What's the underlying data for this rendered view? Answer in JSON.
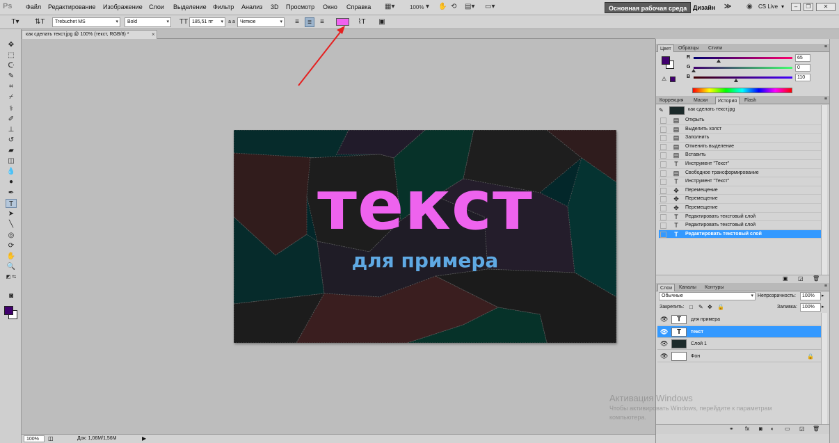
{
  "app": {
    "logo": "Ps"
  },
  "menu": [
    "Файл",
    "Редактирование",
    "Изображение",
    "Слои",
    "Выделение",
    "Фильтр",
    "Анализ",
    "3D",
    "Просмотр",
    "Окно",
    "Справка"
  ],
  "menubar": {
    "zoom": "100%",
    "workspace_active": "Основная рабочая среда",
    "workspace_design": "Дизайн",
    "more": "≫",
    "cs_live": "CS Live"
  },
  "options": {
    "font_family": "Trebuchet MS",
    "font_style": "Bold",
    "font_size": "185,51 пт",
    "aa_label": "a a",
    "antialias": "Четкое",
    "text_color": "#f062f0"
  },
  "document": {
    "tab_title": "как сделать текст.jpg @ 100% (текст, RGB/8) *",
    "close": "×"
  },
  "canvas": {
    "title_text": "текст",
    "subtitle_text": "для примера"
  },
  "status": {
    "zoom": "100%",
    "doc_info": "Док: 1,06М/1,56М",
    "arrow": "▶"
  },
  "color_panel": {
    "tabs": [
      "Цвет",
      "Образцы",
      "Стили"
    ],
    "r_label": "R",
    "g_label": "G",
    "b_label": "B",
    "r": "65",
    "g": "0",
    "b": "110",
    "r_level": 0.255,
    "g_level": 0.0,
    "b_level": 0.431
  },
  "history_panel": {
    "tabs": [
      "Коррекция",
      "Маски",
      "История",
      "Flash"
    ],
    "snapshot": "как сделать текст.jpg",
    "items": [
      {
        "label": "Открыть",
        "icon": "doc-icon"
      },
      {
        "label": "Выделить холст",
        "icon": "doc-icon"
      },
      {
        "label": "Заполнить",
        "icon": "doc-icon"
      },
      {
        "label": "Отменить выделение",
        "icon": "doc-icon"
      },
      {
        "label": "Вставить",
        "icon": "doc-icon"
      },
      {
        "label": "Инструмент \"Текст\"",
        "icon": "text-icon"
      },
      {
        "label": "Свободное трансформирование",
        "icon": "doc-icon"
      },
      {
        "label": "Инструмент \"Текст\"",
        "icon": "text-icon"
      },
      {
        "label": "Перемещение",
        "icon": "move-icon"
      },
      {
        "label": "Перемещение",
        "icon": "move-icon"
      },
      {
        "label": "Перемещение",
        "icon": "move-icon"
      },
      {
        "label": "Редактировать текстовый слой",
        "icon": "text-icon"
      },
      {
        "label": "Редактировать текстовый слой",
        "icon": "text-icon"
      },
      {
        "label": "Редактировать текстовый слой",
        "icon": "text-icon"
      }
    ]
  },
  "layers_panel": {
    "tabs": [
      "Слои",
      "Каналы",
      "Контуры"
    ],
    "blend_mode": "Обычные",
    "opacity_label": "Непрозрачность:",
    "opacity": "100%",
    "lock_label": "Закрепить:",
    "fill_label": "Заливка:",
    "fill": "100%",
    "layers": [
      {
        "name": "для примера",
        "thumb": "T"
      },
      {
        "name": "текст",
        "thumb": "T"
      },
      {
        "name": "Слой 1",
        "thumb": ""
      },
      {
        "name": "Фон",
        "thumb": ""
      }
    ]
  },
  "watermark": {
    "title": "Активация Windows",
    "line1": "Чтобы активировать Windows, перейдите к параметрам",
    "line2": "компьютера."
  }
}
